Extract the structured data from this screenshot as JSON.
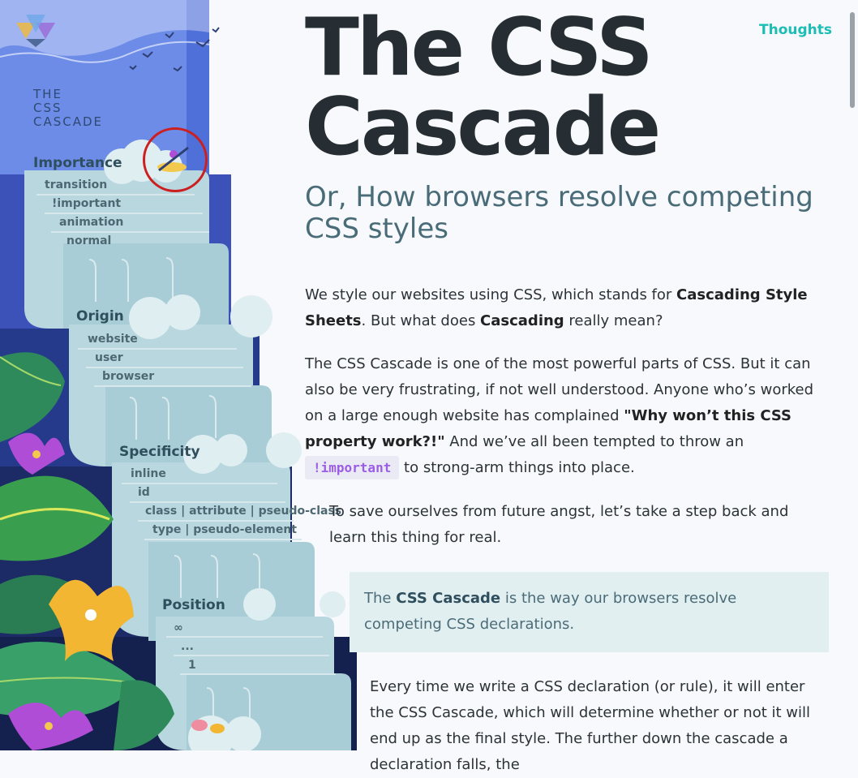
{
  "sidebar": {
    "site_title": "THE\nCSS\nCASCADE",
    "sections": [
      {
        "title": "Importance",
        "items": [
          "transition",
          "!important",
          "animation",
          "normal"
        ]
      },
      {
        "title": "Origin",
        "items": [
          "website",
          "user",
          "browser"
        ]
      },
      {
        "title": "Specificity",
        "items": [
          "inline",
          "id",
          "class | attribute | pseudo-class",
          "type | pseudo-element"
        ]
      },
      {
        "title": "Position",
        "items": [
          "∞",
          "...",
          "1"
        ]
      }
    ]
  },
  "header": {
    "nav_link": "Thoughts"
  },
  "article": {
    "title": "The CSS Cascade",
    "subtitle": "Or, How browsers resolve competing CSS styles",
    "p1": {
      "a": "We style our websites using CSS, which stands for ",
      "b1": "Cascading Style Sheets",
      "c": ". But what does ",
      "b2": "Cascading",
      "d": " really mean?"
    },
    "p2": {
      "a": "The CSS Cascade is one of the most powerful parts of CSS. But it can also be very frustrating, if not well understood. Anyone who’s worked on a large enough website has complained ",
      "b": "\"Why won’t this CSS property work?!\"",
      "c": " And we’ve all been tempted to throw an ",
      "code": "!important",
      "d": " to strong-arm things into place."
    },
    "p3": "To save ourselves from future angst, let’s take a step back and learn this thing for real.",
    "callout": {
      "a": "The ",
      "b": "CSS Cascade",
      "c": " is the way our browsers resolve competing CSS declarations."
    },
    "p4": "Every time we write a CSS declaration (or rule), it will enter the CSS Cascade, which will determine whether or not it will end up as the final style. The further down the cascade a declaration falls, the"
  },
  "colors": {
    "accent": "#1bbdb4",
    "code": "#9b5de5",
    "callout_bg": "#e2eff1",
    "highlight_ring": "#cc1f1f"
  }
}
